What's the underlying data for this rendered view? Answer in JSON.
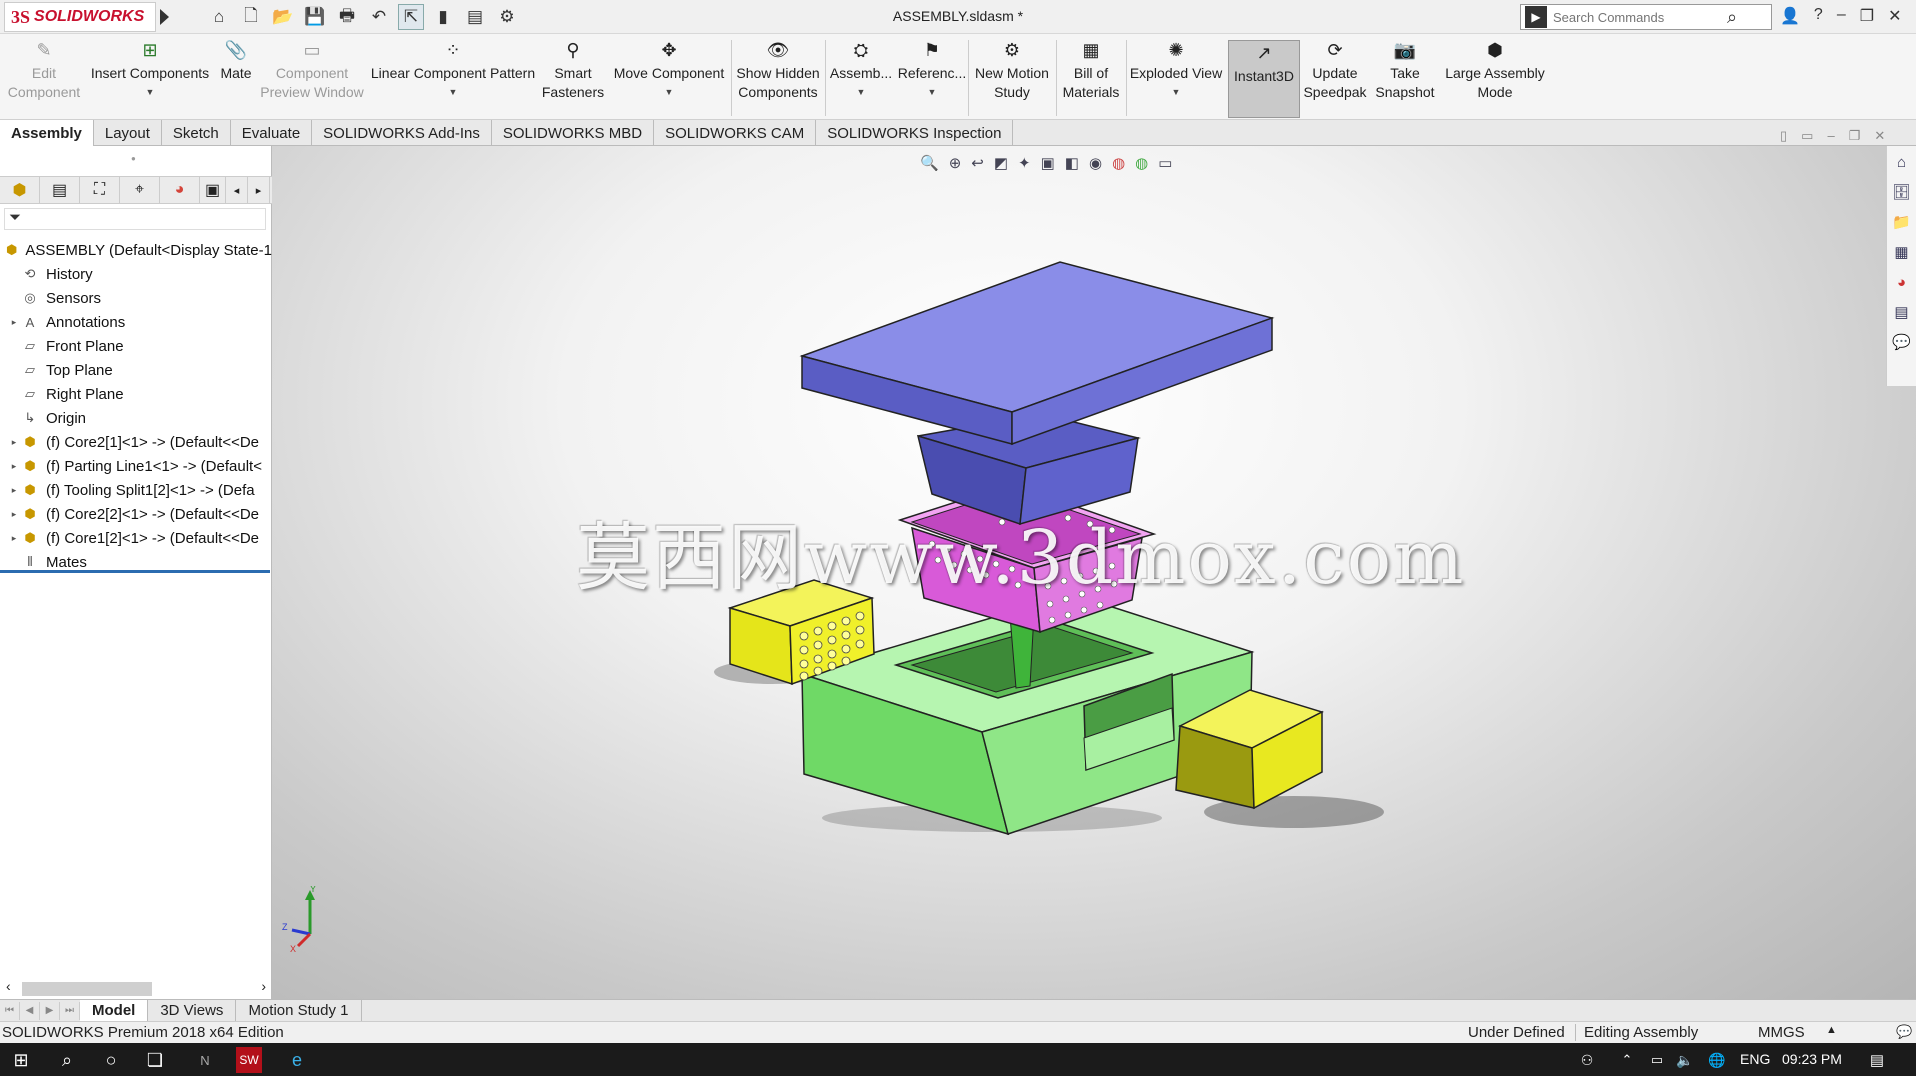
{
  "app": {
    "logo_ds": "3S",
    "logo_name": "SOLIDWORKS",
    "document_title": "ASSEMBLY.sldasm *",
    "search_placeholder": "Search Commands"
  },
  "quick_access": {
    "icons": [
      "home-icon",
      "new-document-icon",
      "open-icon",
      "save-icon",
      "print-icon",
      "undo-icon",
      "select-icon",
      "rebuild-icon",
      "file-properties-icon",
      "options-icon"
    ]
  },
  "command_manager": {
    "items": [
      {
        "label": "Edit\nComponent",
        "icon": "edit-component-icon",
        "enabled": false
      },
      {
        "label": "Insert Components",
        "icon": "insert-components-icon",
        "enabled": true
      },
      {
        "label": "Mate",
        "icon": "mate-icon",
        "enabled": true
      },
      {
        "label": "Component\nPreview Window",
        "icon": "preview-window-icon",
        "enabled": false
      },
      {
        "label": "Linear Component Pattern",
        "icon": "linear-pattern-icon",
        "enabled": true
      },
      {
        "label": "Smart\nFasteners",
        "icon": "smart-fasteners-icon",
        "enabled": true
      },
      {
        "label": "Move Component",
        "icon": "move-component-icon",
        "enabled": true
      },
      {
        "label": "Show Hidden\nComponents",
        "icon": "show-hidden-icon",
        "enabled": true
      },
      {
        "label": "Assemb...",
        "icon": "assembly-features-icon",
        "enabled": true
      },
      {
        "label": "Referenc...",
        "icon": "reference-geometry-icon",
        "enabled": true
      },
      {
        "label": "New Motion\nStudy",
        "icon": "motion-study-icon",
        "enabled": true
      },
      {
        "label": "Bill of\nMaterials",
        "icon": "bom-icon",
        "enabled": true
      },
      {
        "label": "Exploded View",
        "icon": "exploded-view-icon",
        "enabled": true
      },
      {
        "label": "Instant3D",
        "icon": "instant3d-icon",
        "enabled": true,
        "active": true
      },
      {
        "label": "Update\nSpeedpak",
        "icon": "speedpak-icon",
        "enabled": true
      },
      {
        "label": "Take\nSnapshot",
        "icon": "camera-icon",
        "enabled": true
      },
      {
        "label": "Large Assembly\nMode",
        "icon": "large-assembly-icon",
        "enabled": true
      }
    ]
  },
  "tabs": [
    "Assembly",
    "Layout",
    "Sketch",
    "Evaluate",
    "SOLIDWORKS Add-Ins",
    "SOLIDWORKS MBD",
    "SOLIDWORKS CAM",
    "SOLIDWORKS Inspection"
  ],
  "active_tab": "Assembly",
  "tree": [
    {
      "label": "ASSEMBLY  (Default<Display State-1",
      "icon": "assembly-icon",
      "expander": ""
    },
    {
      "label": "History",
      "icon": "history-icon",
      "expander": ""
    },
    {
      "label": "Sensors",
      "icon": "sensors-icon",
      "expander": ""
    },
    {
      "label": "Annotations",
      "icon": "annotations-icon",
      "expander": "▸"
    },
    {
      "label": "Front Plane",
      "icon": "plane-icon",
      "expander": ""
    },
    {
      "label": "Top Plane",
      "icon": "plane-icon",
      "expander": ""
    },
    {
      "label": "Right Plane",
      "icon": "plane-icon",
      "expander": ""
    },
    {
      "label": "Origin",
      "icon": "origin-icon",
      "expander": ""
    },
    {
      "label": "(f) Core2[1]<1> -> (Default<<De",
      "icon": "part-icon",
      "expander": "▸"
    },
    {
      "label": "(f) Parting Line1<1> -> (Default<",
      "icon": "part-icon",
      "expander": "▸"
    },
    {
      "label": "(f) Tooling Split1[2]<1> -> (Defa",
      "icon": "part-icon",
      "expander": "▸"
    },
    {
      "label": "(f) Core2[2]<1> -> (Default<<De",
      "icon": "part-icon",
      "expander": "▸"
    },
    {
      "label": "(f) Core1[2]<1> -> (Default<<De",
      "icon": "part-icon",
      "expander": "▸"
    },
    {
      "label": "Mates",
      "icon": "mates-icon",
      "expander": ""
    }
  ],
  "viewport": {
    "watermark": "莫西网www.3dmox.com",
    "triad": {
      "y": "Y",
      "z": "Z",
      "x": "X"
    },
    "colors": {
      "top_plate": "#7b7ee0",
      "top_plate_side": "#4d50b8",
      "basket": "#d85ad8",
      "slider": "#e5e51a",
      "base": "#8de885"
    }
  },
  "bottom_tabs": [
    "Model",
    "3D Views",
    "Motion Study 1"
  ],
  "active_bottom_tab": "Model",
  "status": {
    "edition": "SOLIDWORKS Premium 2018 x64 Edition",
    "definition": "Under Defined",
    "mode": "Editing Assembly",
    "units": "MMGS"
  },
  "taskbar": {
    "language": "ENG",
    "time": "09:23 PM"
  }
}
